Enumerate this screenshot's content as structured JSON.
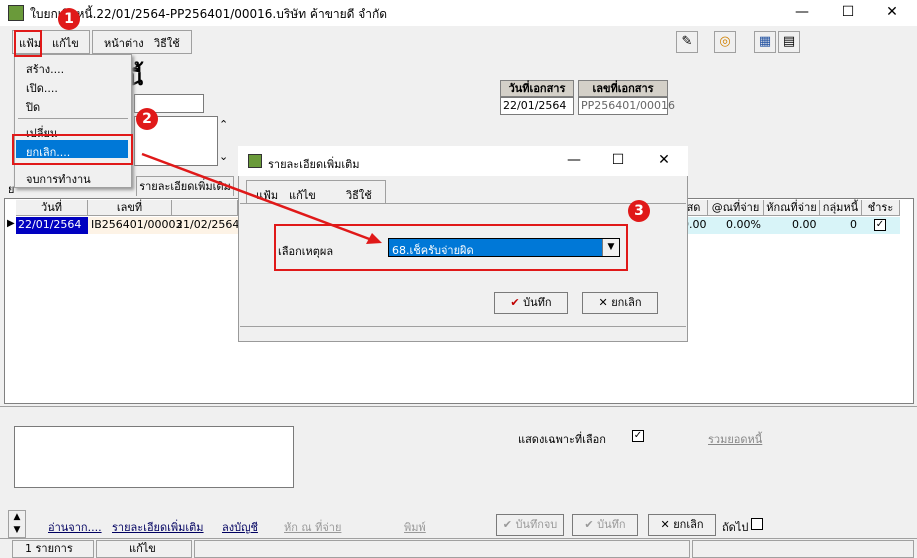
{
  "window": {
    "title": "ใบยกเลิกหนี้.22/01/2564-PP256401/00016.บริษัท ค้าขายดี จำกัด",
    "minimize": "—",
    "maximize": "☐",
    "close": "✕"
  },
  "menubar": {
    "file": "แฟ้ม",
    "edit": "แก้ไข",
    "window": "หน้าต่าง",
    "howto": "วิธีใช้"
  },
  "file_menu": {
    "items": [
      "สร้าง....",
      "เปิด....",
      "ปิด",
      "เปลี่ยน",
      "ยกเลิก....",
      "จบการทำงาน"
    ]
  },
  "form": {
    "title": "นี้",
    "doc_date_label": "วันที่เอกสาร",
    "doc_no_label": "เลขที่เอกสาร",
    "doc_date": "22/01/2564",
    "doc_no": "PP256401/00016"
  },
  "tabs": [
    "ย",
    "รายละเอียดเพิ่มเติม"
  ],
  "grid": {
    "columns": [
      "วันที่",
      "เลขที่",
      "สด",
      "@ณที่จ่าย",
      "หักณที่จ่าย",
      "กลุ่มหนี้",
      "ชำระ"
    ],
    "row": {
      "date": "22/01/2564",
      "number": "IB256401/00003",
      "due": "21/02/2564",
      "cash": "0.00",
      "wht_rate": "0.00%",
      "wht": "0.00",
      "group": "0",
      "paid": "✓"
    }
  },
  "dialog": {
    "title": "รายละเอียดเพิ่มเติม",
    "menu": [
      "แฟ้ม",
      "แก้ไข",
      "วิธีใช้"
    ],
    "reason_label": "เลือกเหตุผล",
    "reason_value": "68.เช็ครับจ่ายผิด",
    "save": "บันทึก",
    "cancel": "ยกเลิก"
  },
  "bottom": {
    "show_selected": "แสดงเฉพาะที่เลือก",
    "show_selected_checked": "✓",
    "total_link": "รวมยอดหนี้",
    "read_from": "อ่านจาก....",
    "more_detail": "รายละเอียดเพิ่มเติม",
    "post": "ลงบัญชี",
    "wht": "หัก ณ ที่จ่าย",
    "print": "พิมพ์",
    "save_close": "บันทึกจบ",
    "save": "บันทึก",
    "cancel": "ยกเลิก",
    "next": "ถัดไป"
  },
  "status": {
    "count": "1 รายการ",
    "mode": "แก้ไข"
  },
  "annotations": {
    "step1": "1",
    "step2": "2",
    "step3": "3"
  },
  "colors": {
    "annotation_red": "#e01919",
    "selection_blue": "#0078d7",
    "row_highlight": "#0000c0"
  }
}
